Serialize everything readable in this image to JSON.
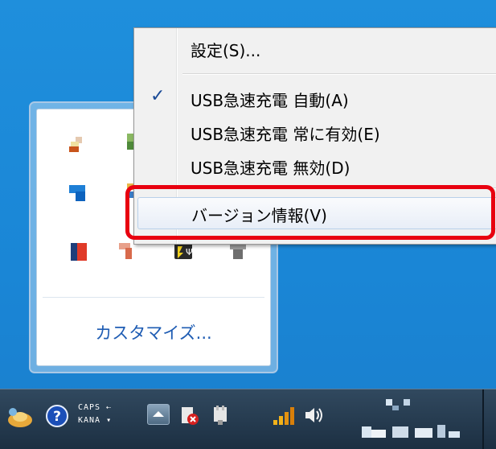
{
  "flyout": {
    "customize_label": "カスタマイズ..."
  },
  "context_menu": {
    "items": [
      {
        "label": "設定(S)...",
        "checked": false
      },
      {
        "label": "USB急速充電 自動(A)",
        "checked": true
      },
      {
        "label": "USB急速充電 常に有効(E)",
        "checked": false
      },
      {
        "label": "USB急速充電 無効(D)",
        "checked": false
      },
      {
        "label": "バージョン情報(V)",
        "checked": false,
        "highlighted": true
      }
    ],
    "check_glyph": "✓"
  },
  "taskbar": {
    "caps_label": "CAPS",
    "kana_label": "KANA"
  },
  "colors": {
    "highlight_border": "#e8000f",
    "link": "#1e5cb3",
    "desktop": "#1a86d6"
  }
}
